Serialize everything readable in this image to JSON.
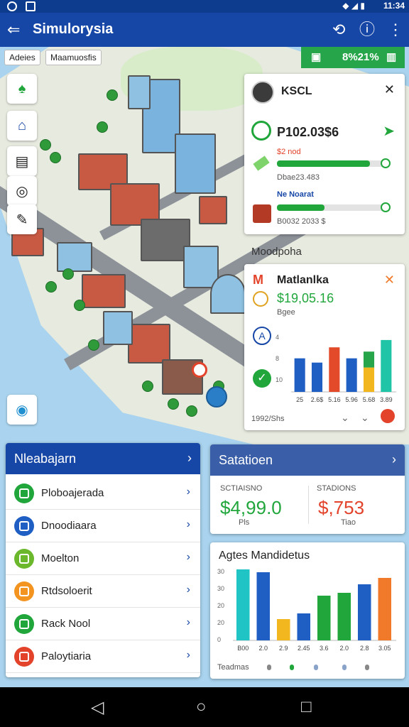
{
  "app": {
    "title": "Simulorysia"
  },
  "statusbar": {
    "time": "11:34"
  },
  "map": {
    "chips": [
      "Adeies",
      "Maamuosfis"
    ],
    "status_value": "8%21%"
  },
  "profile_card": {
    "name": "KSCL",
    "value": "P102.03$6",
    "label1": "$2 nod",
    "sub1": "Dbae23.483",
    "progress1": 0.84,
    "label2": "Ne Noarat",
    "sub2": "B0032 2033 $",
    "progress2": 0.43
  },
  "section_label": "Moodpoha",
  "chart_card": {
    "title": "Matlanlka",
    "value": "$19,05.16",
    "sub": "Bgee",
    "footer": "1992/Shs"
  },
  "chart_data": [
    {
      "type": "bar",
      "categories": [
        "25",
        "2.6$",
        "5.16",
        "5.96",
        "5.68",
        "3.89"
      ],
      "series": [
        {
          "values": [
            55,
            48,
            73,
            55,
            40,
            85
          ]
        },
        {
          "values": [
            0,
            0,
            0,
            0,
            26,
            0
          ]
        }
      ],
      "colors": [
        "#1f5fc4",
        "#1f5fc4",
        "#e24a2a",
        "#1f5fc4",
        "#f2b61f",
        "#20c4a6"
      ],
      "stack_colors": [
        "#27a54a"
      ],
      "y_ticks": [
        "4",
        "8",
        "10"
      ]
    },
    {
      "type": "bar",
      "categories": [
        "B00",
        "2.0",
        "2.9",
        "2.45",
        "3.6",
        "2.0",
        "2.8",
        "3.05"
      ],
      "values": [
        100,
        96,
        30,
        38,
        63,
        67,
        79,
        88
      ],
      "colors": [
        "#20c4c4",
        "#1f5fc4",
        "#f2b61f",
        "#1f5fc4",
        "#21a63c",
        "#21a63c",
        "#1f5fc4",
        "#f07a2a"
      ],
      "y_ticks": [
        "30",
        "30",
        "20",
        "20",
        "0"
      ],
      "title": "Agtes Mandidetus",
      "footer": "Teadmas"
    }
  ],
  "list_panel": {
    "title": "Nleabajarn",
    "items": [
      {
        "label": "Ploboajerada",
        "color": "#21a63c"
      },
      {
        "label": "Dnoodiaara",
        "color": "#1f5fc4"
      },
      {
        "label": "Moelton",
        "color": "#6cb82d"
      },
      {
        "label": "Rtdsoloerit",
        "color": "#f2941f"
      },
      {
        "label": "Rack Nool",
        "color": "#21a63c"
      },
      {
        "label": "Paloytiaria",
        "color": "#e2432a"
      }
    ]
  },
  "stats_panel": {
    "title": "Satatioen",
    "left_label": "SCTIAISNO",
    "left_value": "$4,99.0",
    "left_sub": "Pls",
    "right_label": "STADIONS",
    "right_value": "$,753",
    "right_sub": "Tiao"
  }
}
